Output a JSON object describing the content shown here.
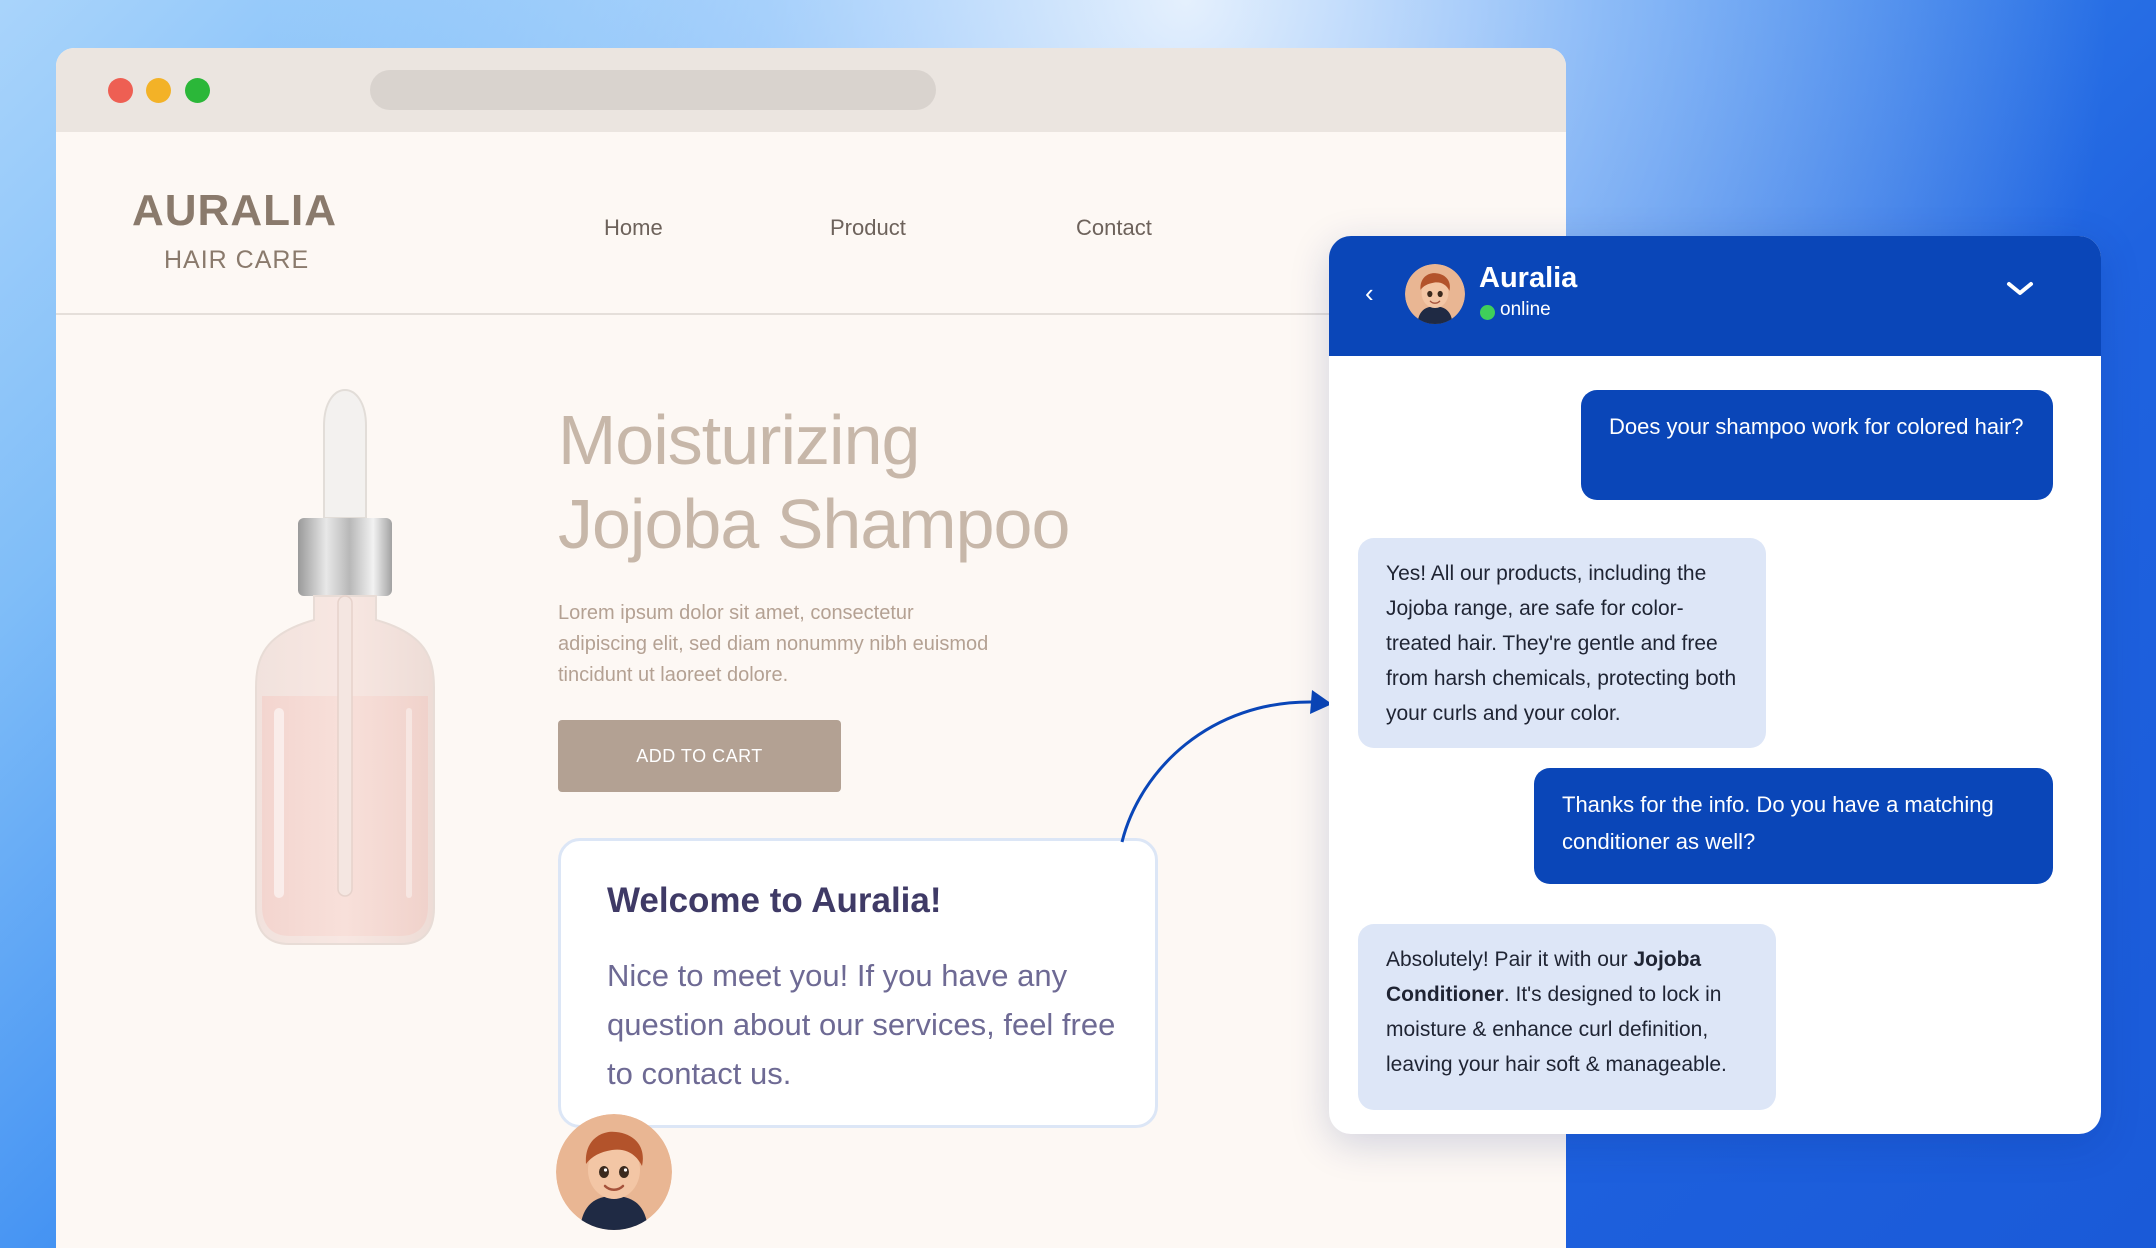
{
  "site": {
    "brand_name": "AURALIA",
    "brand_sub": "HAIR CARE",
    "nav": [
      "Home",
      "Product",
      "Contact"
    ]
  },
  "product": {
    "title_line1": "Moisturizing",
    "title_line2": "Jojoba Shampoo",
    "description": "Lorem ipsum dolor sit amet, consectetur adipiscing elit, sed diam nonummy nibh euismod tincidunt ut laoreet dolore.",
    "cta_label": "ADD TO CART"
  },
  "welcome": {
    "title": "Welcome to Auralia!",
    "text": "Nice to meet you! If you have any question about our services, feel free to contact us."
  },
  "chat": {
    "name": "Auralia",
    "status": "online",
    "back_icon": "chevron-left-icon",
    "collapse_icon": "chevron-down-icon",
    "messages": [
      {
        "from": "user",
        "text": "Does your shampoo work for colored hair?"
      },
      {
        "from": "bot",
        "text": "Yes! All our products, including the Jojoba range, are safe for color-treated hair. They're gentle and free from harsh chemicals, protecting both your curls and your color."
      },
      {
        "from": "user",
        "text": "Thanks for the info. Do you have a matching conditioner as well?"
      },
      {
        "from": "bot",
        "text_before": "Absolutely! Pair it with our ",
        "text_bold": "Jojoba Conditioner",
        "text_after": ". It's designed to lock in moisture & enhance curl definition, leaving your hair soft & manageable."
      }
    ]
  },
  "colors": {
    "chat_header": "#0a46b8",
    "user_bubble": "#0a46b8",
    "bot_bubble": "#dde6f7",
    "cta": "#b3a193",
    "online": "#3fcf5a"
  }
}
